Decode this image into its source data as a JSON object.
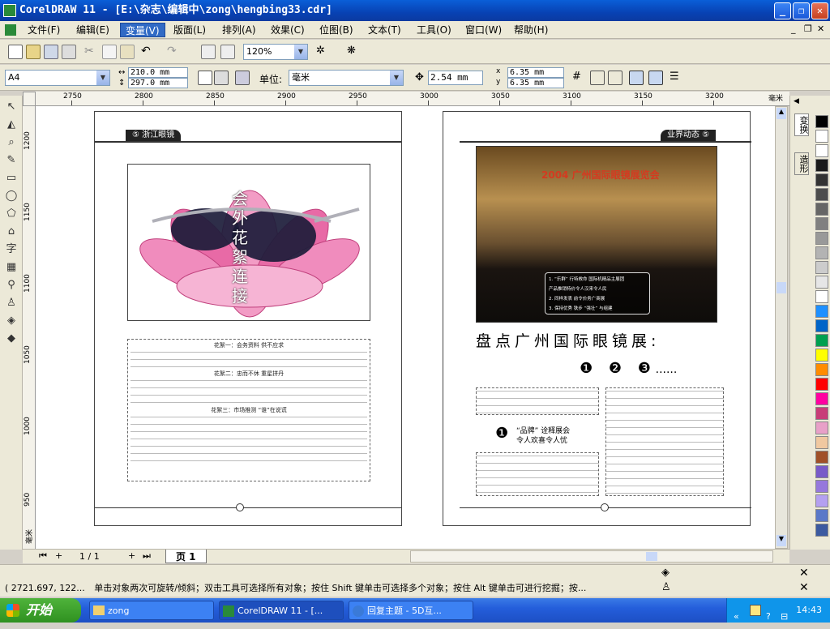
{
  "window": {
    "title": "CorelDRAW 11 - [E:\\杂志\\编辑中\\zong\\hengbing33.cdr]"
  },
  "menu": [
    {
      "label": "文件(F)"
    },
    {
      "label": "编辑(E)"
    },
    {
      "label": "变量(V)",
      "active": true
    },
    {
      "label": "版面(L)"
    },
    {
      "label": "排列(A)"
    },
    {
      "label": "效果(C)"
    },
    {
      "label": "位图(B)"
    },
    {
      "label": "文本(T)"
    },
    {
      "label": "工具(O)"
    },
    {
      "label": "窗口(W)"
    },
    {
      "label": "帮助(H)"
    }
  ],
  "toolbar1": {
    "zoom": "120%"
  },
  "propbar": {
    "page_size": "A4",
    "width": "210.0 mm",
    "height": "297.0 mm",
    "unit_label": "单位:",
    "unit": "毫米",
    "nudge": "2.54 mm",
    "dup_x": "6.35 mm",
    "dup_y": "6.35 mm"
  },
  "ruler": {
    "h_labels": [
      "2750",
      "2800",
      "2850",
      "2900",
      "2950",
      "3000",
      "3050",
      "3100",
      "3150",
      "3200"
    ],
    "h_unit": "毫米",
    "v_labels": [
      "1200",
      "1150",
      "1100",
      "1050",
      "1000",
      "950"
    ],
    "v_unit": "毫米"
  },
  "left_page": {
    "header": "⑤ 浙江眼镜",
    "image_caption": "会外花絮连接",
    "section1": "花絮一：会务资料  供不应求",
    "section2": "花絮二：忠而不休  重星拼丹",
    "section3": "花絮三：市场推测  “谁”在说谎"
  },
  "right_page": {
    "header": "业界动态 ⑤",
    "banner_title": "2004 广州国际眼镜展览会",
    "photo_overlay": [
      "1. “乐群” 行特救命 国际机精品主展团",
      "   产品推销特价令人汉来令人民",
      "2. 同样发表 前令价务广商展",
      "3. 保持优秀 铁步 “强壮” 与组建"
    ],
    "heading": "盘点广州国际眼镜展:",
    "numbers": [
      "❶",
      "❷",
      "❸",
      "......"
    ],
    "sub_heading": "“品牌” 诠释展会\n令人欢喜令人忧"
  },
  "nav": {
    "page_indicator": "1 / 1",
    "page_tab": "页 1"
  },
  "status": {
    "coords": "( 2721.697, 122...",
    "hint": "单击对象两次可旋转/倾斜；双击工具可选择所有对象；按住 Shift 键单击可选择多个对象；按住 Alt 键单击可进行挖掘；按..."
  },
  "dockers": [
    "变换",
    "造形"
  ],
  "taskbar": {
    "start": "开始",
    "tasks": [
      {
        "label": "zong"
      },
      {
        "label": "CorelDRAW 11 - [..."
      },
      {
        "label": "回复主题 - 5D互..."
      }
    ],
    "clock": "14:43"
  },
  "colors": {
    "accent": "#316ac5",
    "title_bar": "#0842b4"
  },
  "palette": [
    "#000000",
    "#ffffff",
    "#ffffff",
    "#1a1a1a",
    "#333333",
    "#4d4d4d",
    "#666666",
    "#808080",
    "#999999",
    "#b3b3b3",
    "#cccccc",
    "#e6e6e6",
    "#ffffff",
    "#1e90ff",
    "#0064c8",
    "#00a050",
    "#ffff00",
    "#ff8c00",
    "#ff0000",
    "#ff00a0",
    "#c83c78",
    "#e8a0c8",
    "#f0c8a0",
    "#a05028",
    "#785ac8",
    "#9678dc",
    "#b4a0f0",
    "#5a78c8",
    "#3c5aa0"
  ]
}
